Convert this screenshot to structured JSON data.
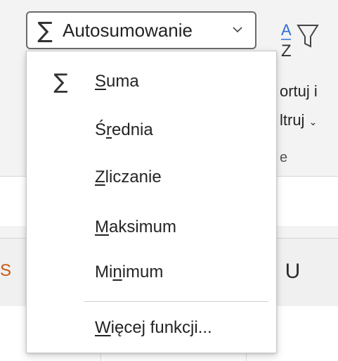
{
  "ribbon": {
    "autosum": {
      "icon": "sigma-icon",
      "label": "Autosumowanie",
      "chevron": "chevron-down-icon"
    },
    "sort_filter": {
      "icon": "sort-filter-icon",
      "line1": "ortuj i",
      "line2": "ltruj",
      "group_tail": "e"
    }
  },
  "menu": {
    "items": [
      {
        "pre": "",
        "key": "S",
        "post": "uma",
        "icon": "sigma-icon"
      },
      {
        "pre": "Ś",
        "key": "r",
        "post": "ednia"
      },
      {
        "pre": "",
        "key": "Z",
        "post": "liczanie"
      },
      {
        "pre": "",
        "key": "M",
        "post": "aksimum"
      },
      {
        "pre": "Mi",
        "key": "n",
        "post": "imum"
      },
      {
        "pre": "",
        "key": "W",
        "post": "ięcej funkcji..."
      }
    ]
  },
  "sheet": {
    "column_header": "U",
    "partial_left_header": "S"
  },
  "colors": {
    "accent_blue": "#2f6fd6",
    "sheet_orange": "#c55a11"
  }
}
